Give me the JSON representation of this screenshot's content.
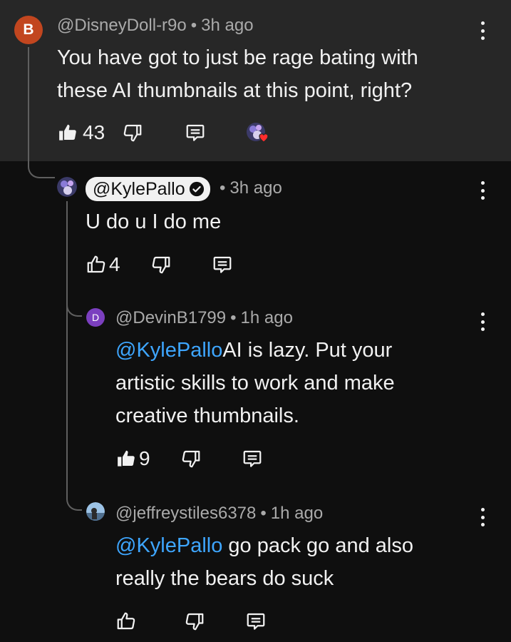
{
  "comments": [
    {
      "author": "@DisneyDoll-r9o",
      "avatar_letter": "B",
      "avatar_color": "#c2461f",
      "time": "3h ago",
      "text_lines": [
        "You have got to just be rage bating with",
        "these AI thumbnails at this point, right?"
      ],
      "likes": "43",
      "liked": true
    },
    {
      "author": "@KylePallo",
      "time": "3h ago",
      "text": "U do u I do me",
      "likes": "4",
      "liked": false,
      "verified": true
    },
    {
      "author": "@DevinB1799",
      "avatar_letter": "D",
      "avatar_color": "#7b3fbf",
      "time": "1h ago",
      "mention": "@KylePallo",
      "text_lines": [
        "AI is lazy. Put your",
        "artistic skills to work and make",
        "creative thumbnails."
      ],
      "likes": "9",
      "liked": true
    },
    {
      "author": "@jeffreystiles6378",
      "time": "1h ago",
      "mention": "@KylePallo",
      "text_lines": [
        " go pack go and also",
        "really the bears do suck"
      ],
      "likes": "",
      "liked": false
    }
  ],
  "colors": {
    "background": "#0f0f0f",
    "highlight_background": "#272727",
    "mention": "#3ea6ff",
    "meta": "#aaaaaa"
  },
  "icons": {
    "like": "thumbs-up-icon",
    "dislike": "thumbs-down-icon",
    "reply": "reply-icon",
    "more": "more-vertical-icon",
    "verified": "verified-check-icon",
    "creator_heart": "creator-heart-icon"
  }
}
